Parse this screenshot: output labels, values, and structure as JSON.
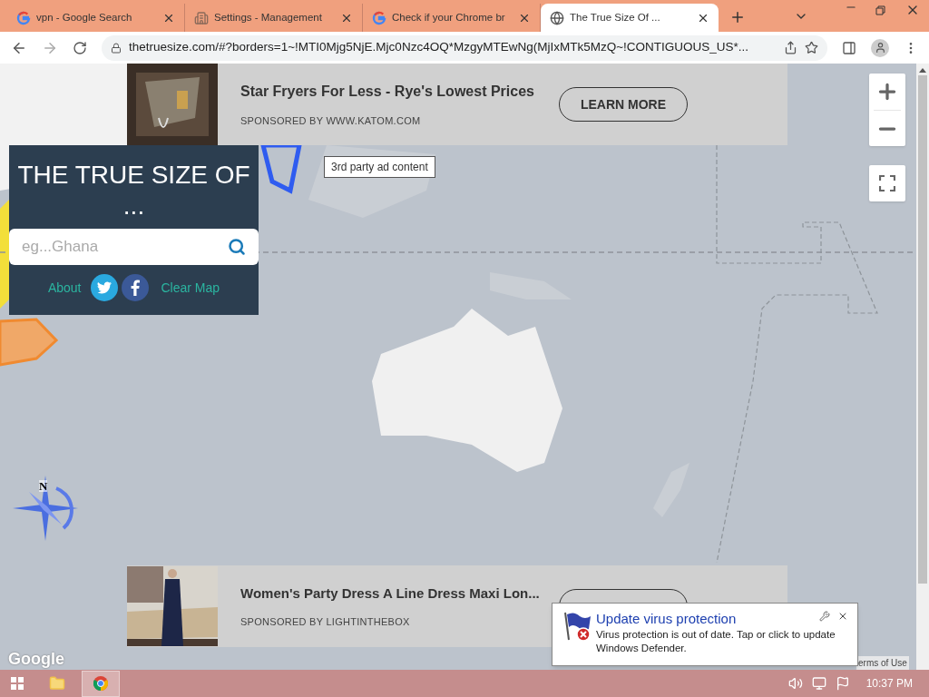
{
  "tabs": [
    {
      "title": "vpn - Google Search",
      "kind": "google",
      "selected": false
    },
    {
      "title": "Settings - Management",
      "kind": "building",
      "selected": false
    },
    {
      "title": "Check if your Chrome br",
      "kind": "google",
      "selected": false
    },
    {
      "title": "The True Size Of ...",
      "kind": "globe",
      "selected": true
    }
  ],
  "address": "thetruesize.com/#?borders=1~!MTI0Mjg5NjE.Mjc0Nzc4OQ*MzgyMTEwNg(MjIxMTk5MzQ~!CONTIGUOUS_US*...",
  "panel": {
    "title": "THE TRUE SIZE OF ...",
    "placeholder": "eg...Ghana",
    "links": [
      "About",
      "Clear Map"
    ]
  },
  "ads": [
    {
      "title": "Star Fryers For Less - Rye's Lowest Prices",
      "sponsor": "SPONSORED BY WWW.KATOM.COM",
      "button": "LEARN MORE"
    },
    {
      "title": "Women's Party Dress A Line Dress Maxi Lon...",
      "sponsor": "SPONSORED BY LIGHTINTHEBOX"
    }
  ],
  "tooltip": "3rd party ad content",
  "compass": "N",
  "attribution": "Google",
  "terms": "erms of Use",
  "notification": {
    "title": "Update virus protection",
    "body": "Virus protection is out of date. Tap or click to update Windows Defender."
  },
  "clock": "10:37 PM"
}
